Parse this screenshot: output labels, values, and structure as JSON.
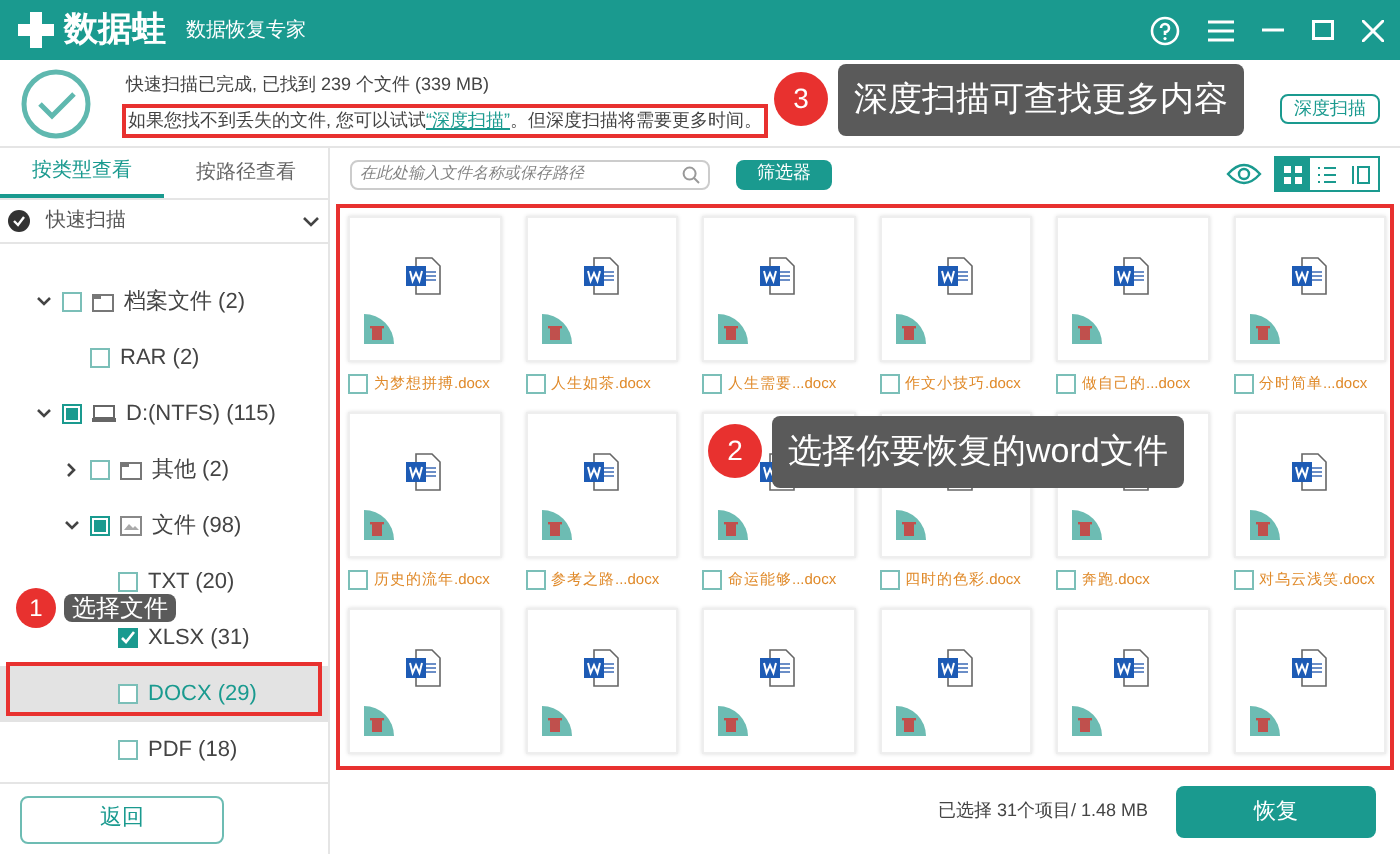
{
  "window": {
    "app_name": "数据蛙",
    "subtitle": "数据恢复专家"
  },
  "scan_summary": {
    "status": "快速扫描已完成, 已找到 239 个文件 (339 MB)",
    "hint_before": "如果您找不到丢失的文件, 您可以试试",
    "hint_link": "“深度扫描”",
    "hint_after": "。但深度扫描将需要更多时间。",
    "deep_scan_button": "深度扫描"
  },
  "view_tabs": [
    {
      "label": "按类型查看",
      "selected": true
    },
    {
      "label": "按路径查看",
      "selected": false
    }
  ],
  "scan_mode": {
    "label": "快速扫描"
  },
  "tree": [
    {
      "label": "档案文件 (2)",
      "kind": "folder",
      "expanded": true,
      "checked": false,
      "partial": false,
      "selected": false,
      "children": [
        {
          "label": "RAR (2)",
          "checked": false,
          "partial": false,
          "selected": false
        }
      ]
    },
    {
      "label": "D:(NTFS) (115)",
      "kind": "drive",
      "expanded": true,
      "checked": false,
      "partial": true,
      "selected": false,
      "children": [
        {
          "label": "其他 (2)",
          "kind": "folder",
          "expanded": false,
          "checked": false,
          "partial": false,
          "selected": false
        },
        {
          "label": "文件 (98)",
          "kind": "image",
          "expanded": true,
          "checked": false,
          "partial": true,
          "selected": false,
          "children": [
            {
              "label": "TXT (20)",
              "checked": false,
              "partial": false,
              "selected": false
            },
            {
              "label": "XLSX (31)",
              "checked": true,
              "partial": false,
              "selected": false
            },
            {
              "label": "DOCX (29)",
              "checked": false,
              "partial": false,
              "selected": true
            },
            {
              "label": "PDF (18)",
              "checked": false,
              "partial": false,
              "selected": false
            }
          ]
        }
      ]
    }
  ],
  "back_button": "返回",
  "search": {
    "placeholder": "在此处输入文件名称或保存路径"
  },
  "filter_button": "筛选器",
  "view_modes": [
    {
      "kind": "grid",
      "selected": true
    },
    {
      "kind": "list",
      "selected": false
    },
    {
      "kind": "detail",
      "selected": false
    }
  ],
  "files": [
    {
      "kind": "card",
      "name": "为梦想拼搏.docx",
      "checked": false
    },
    {
      "kind": "card",
      "name": "人生如茶.docx",
      "checked": false
    },
    {
      "kind": "card",
      "name": "人生需要...docx",
      "checked": false
    },
    {
      "kind": "card",
      "name": "作文小技巧.docx",
      "checked": false
    },
    {
      "kind": "card",
      "name": "做自己的...docx",
      "checked": false
    },
    {
      "kind": "card",
      "name": "分时简单...docx",
      "checked": false
    },
    {
      "kind": "card",
      "name": "历史的流年.docx",
      "checked": false
    },
    {
      "kind": "card",
      "name": "参考之路...docx",
      "checked": false
    },
    {
      "kind": "card",
      "name": "命运能够...docx",
      "checked": false
    },
    {
      "kind": "card",
      "name": "四时的色彩.docx",
      "checked": false
    },
    {
      "kind": "card",
      "name": "奔跑.docx",
      "checked": false
    },
    {
      "kind": "card",
      "name": "对乌云浅笑.docx",
      "checked": false
    },
    {
      "kind": "thumbnail"
    },
    {
      "kind": "thumbnail"
    },
    {
      "kind": "thumbnail"
    },
    {
      "kind": "thumbnail"
    },
    {
      "kind": "thumbnail"
    },
    {
      "kind": "thumbnail"
    }
  ],
  "status": {
    "selection": "已选择 31个项目/ 1.48 MB",
    "recover_button": "恢复"
  },
  "annotations": [
    {
      "number": "3",
      "text": "深度扫描可查找更多内容"
    },
    {
      "number": "2",
      "text": "选择你要恢复的word文件"
    },
    {
      "number": "1",
      "text": "选择文件"
    }
  ]
}
